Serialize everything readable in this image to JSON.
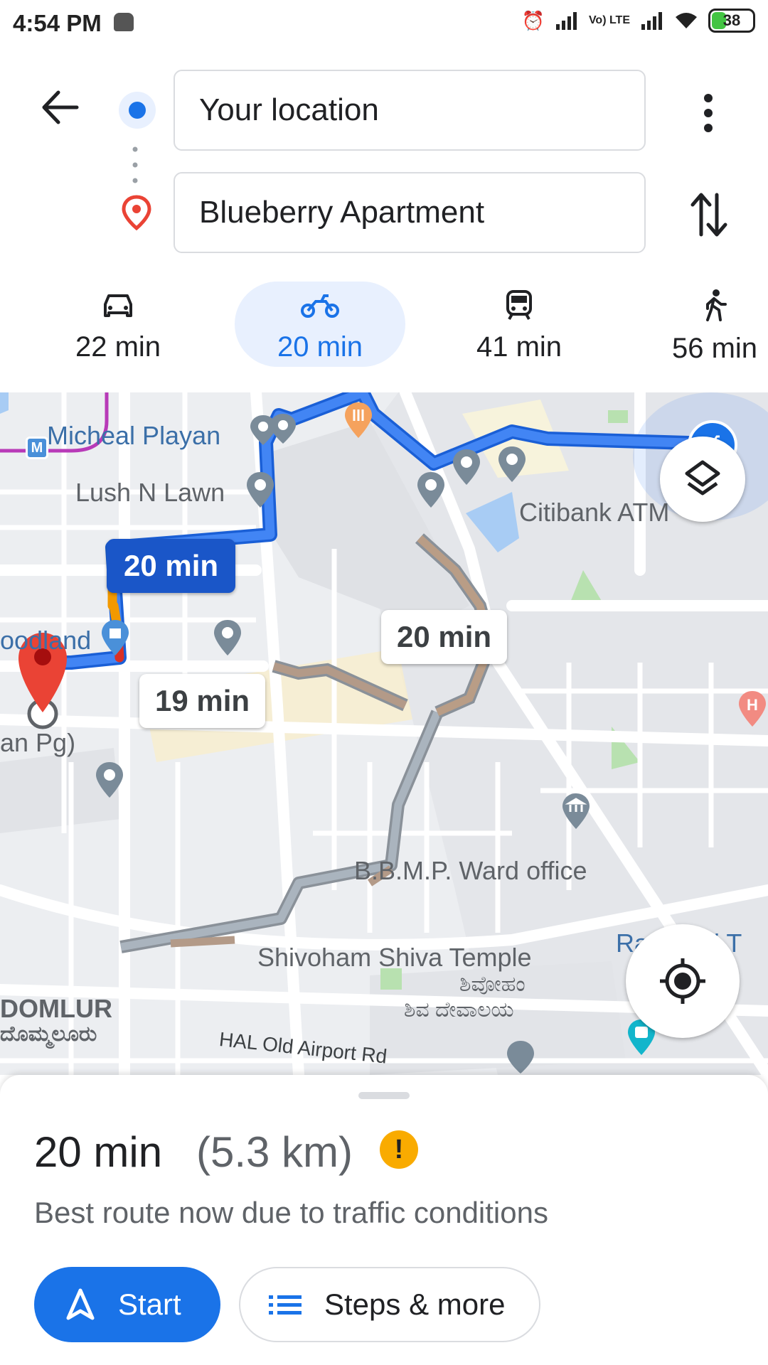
{
  "status_bar": {
    "time": "4:54 PM",
    "battery": "38",
    "network": "Vo) LTE"
  },
  "header": {
    "origin_value": "Your location",
    "destination_value": "Blueberry Apartment"
  },
  "modes": [
    {
      "name": "car",
      "label": "22 min",
      "active": false
    },
    {
      "name": "motorbike",
      "label": "20 min",
      "active": true
    },
    {
      "name": "transit",
      "label": "41 min",
      "active": false
    },
    {
      "name": "walk",
      "label": "56 min",
      "active": false
    }
  ],
  "map": {
    "route_bubbles": {
      "selected": "20 min",
      "alt1": "20 min",
      "alt2": "19 min"
    },
    "labels": {
      "micheal": "Micheal Playan",
      "lush": "Lush N Lawn",
      "woodland": "oodland",
      "pg": "an Pg)",
      "citibank": "Citibank ATM",
      "bbmp": "B.B.M.P. Ward office",
      "temple": "Shivoham Shiva Temple",
      "temple_kn": "ಶಿವೋಹಂ",
      "temple_kn2": "ಶಿವ ದೇವಾಲಯ",
      "domlur": "DOMLUR",
      "domlur_kn": "ದೊಮ್ಮಲೂರು",
      "hal": "HAL Old Airport Rd",
      "rajeshwari": "Ra      ari T",
      "metro": "M",
      "hospital": "H"
    }
  },
  "summary": {
    "time": "20 min",
    "distance": "(5.3 km)",
    "note": "Best route now due to traffic conditions",
    "warning_glyph": "!"
  },
  "actions": {
    "start": "Start",
    "steps": "Steps & more"
  },
  "colors": {
    "accent": "#1a73e8",
    "route": "#4285f4",
    "warning": "#f9ab00"
  }
}
